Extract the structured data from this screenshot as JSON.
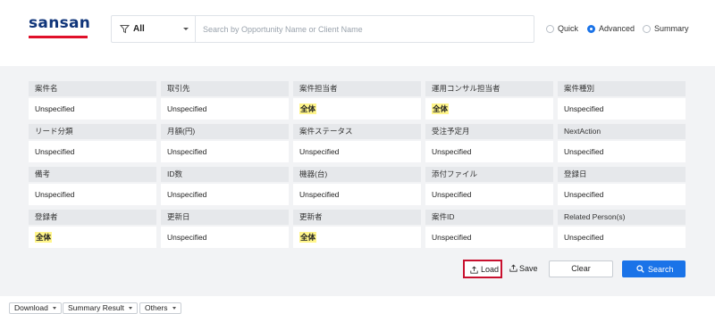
{
  "logo": {
    "text": "sansan",
    "bar_color": "#e0102a",
    "text_color": "#10357a"
  },
  "search": {
    "filter_label": "All",
    "filter_icon": "funnel-icon",
    "placeholder": "Search by Opportunity Name or Client Name",
    "value": ""
  },
  "modes": [
    {
      "label": "Quick",
      "selected": false
    },
    {
      "label": "Advanced",
      "selected": true
    },
    {
      "label": "Summary",
      "selected": false
    }
  ],
  "fields": [
    [
      {
        "label": "案件名",
        "value": "Unspecified",
        "highlight": false
      },
      {
        "label": "取引先",
        "value": "Unspecified",
        "highlight": false
      },
      {
        "label": "案件担当者",
        "value": "全体",
        "highlight": true
      },
      {
        "label": "運用コンサル担当者",
        "value": "全体",
        "highlight": true
      },
      {
        "label": "案件種別",
        "value": "Unspecified",
        "highlight": false
      }
    ],
    [
      {
        "label": "リード分類",
        "value": "Unspecified",
        "highlight": false
      },
      {
        "label": "月額(円)",
        "value": "Unspecified",
        "highlight": false
      },
      {
        "label": "案件ステータス",
        "value": "Unspecified",
        "highlight": false
      },
      {
        "label": "受注予定月",
        "value": "Unspecified",
        "highlight": false
      },
      {
        "label": "NextAction",
        "value": "Unspecified",
        "highlight": false
      }
    ],
    [
      {
        "label": "備考",
        "value": "Unspecified",
        "highlight": false
      },
      {
        "label": "ID数",
        "value": "Unspecified",
        "highlight": false
      },
      {
        "label": "機器(台)",
        "value": "Unspecified",
        "highlight": false
      },
      {
        "label": "添付ファイル",
        "value": "Unspecified",
        "highlight": false
      },
      {
        "label": "登録日",
        "value": "Unspecified",
        "highlight": false
      }
    ],
    [
      {
        "label": "登録者",
        "value": "全体",
        "highlight": true
      },
      {
        "label": "更新日",
        "value": "Unspecified",
        "highlight": false
      },
      {
        "label": "更新者",
        "value": "全体",
        "highlight": true
      },
      {
        "label": "案件ID",
        "value": "Unspecified",
        "highlight": false
      },
      {
        "label": "Related Person(s)",
        "value": "Unspecified",
        "highlight": false
      }
    ]
  ],
  "actions": {
    "load_label": "Load",
    "save_label": "Save",
    "clear_label": "Clear",
    "search_label": "Search",
    "load_icon": "upload-icon",
    "save_icon": "upload-icon",
    "search_icon": "search-icon"
  },
  "toolbar": [
    {
      "label": "Download"
    },
    {
      "label": "Summary Result"
    },
    {
      "label": "Others"
    }
  ],
  "colors": {
    "accent": "#1a73e8",
    "highlight": "#fff58a",
    "panel_bg": "#f2f3f5",
    "load_outline": "#c8102e"
  }
}
